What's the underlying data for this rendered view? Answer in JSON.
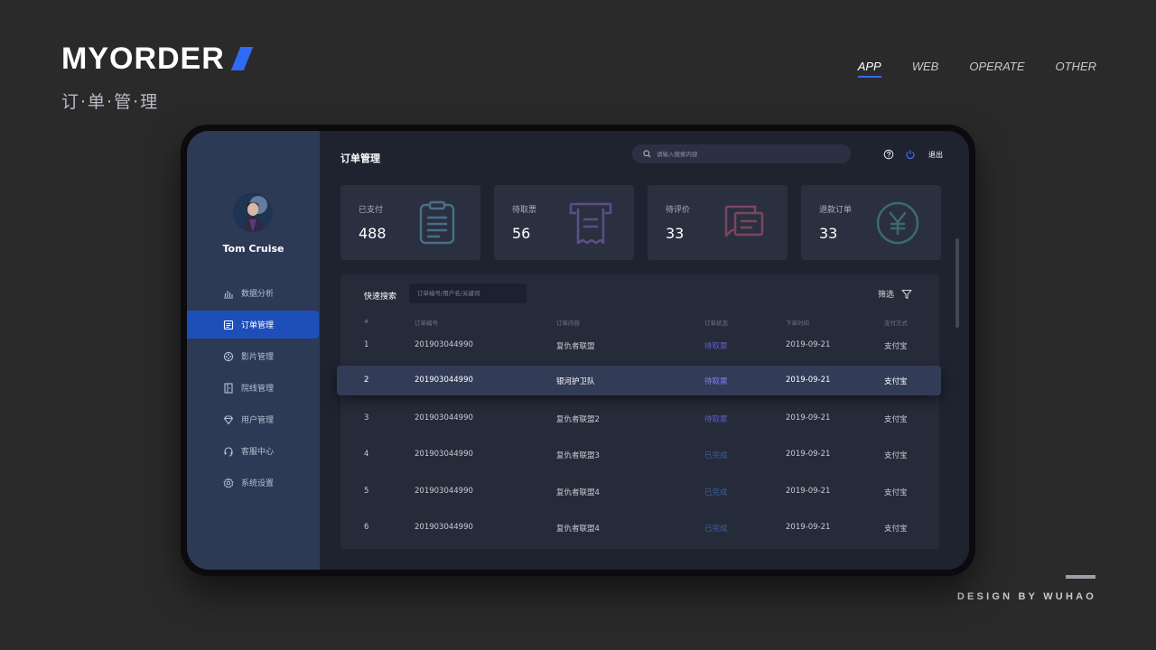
{
  "brand": {
    "title": "MYORDER",
    "subtitle": "订·单·管·理"
  },
  "topnav": [
    {
      "label": "APP",
      "active": true
    },
    {
      "label": "WEB",
      "active": false
    },
    {
      "label": "OPERATE",
      "active": false
    },
    {
      "label": "OTHER",
      "active": false
    }
  ],
  "footer": {
    "credit": "DESIGN BY WUHAO"
  },
  "user": {
    "name": "Tom Cruise"
  },
  "menu": [
    {
      "label": "数据分析",
      "icon": "bar-chart-icon",
      "active": false
    },
    {
      "label": "订单管理",
      "icon": "document-icon",
      "active": true
    },
    {
      "label": "影片管理",
      "icon": "film-reel-icon",
      "active": false
    },
    {
      "label": "院线管理",
      "icon": "door-icon",
      "active": false
    },
    {
      "label": "用户管理",
      "icon": "diamond-icon",
      "active": false
    },
    {
      "label": "客服中心",
      "icon": "headset-icon",
      "active": false
    },
    {
      "label": "系统设置",
      "icon": "gear-icon",
      "active": false
    }
  ],
  "header": {
    "title": "订单管理",
    "search_placeholder": "请输入搜索内容",
    "logout_label": "退出"
  },
  "cards": [
    {
      "label": "已支付",
      "value": "488",
      "icon": "clipboard-icon",
      "color": "#4a6e86"
    },
    {
      "label": "待取票",
      "value": "56",
      "icon": "receipt-icon",
      "color": "#5b4f86"
    },
    {
      "label": "待评价",
      "value": "33",
      "icon": "comment-icon",
      "color": "#7a4660"
    },
    {
      "label": "退款订单",
      "value": "33",
      "icon": "yen-circle-icon",
      "color": "#3c6b66"
    }
  ],
  "table": {
    "quick_search_label": "快速搜索",
    "quick_search_placeholder": "订单编号/用户名/关键词",
    "filter_label": "筛选",
    "columns": [
      "#",
      "订单编号",
      "订单内容",
      "订单状态",
      "下单时间",
      "支付方式"
    ],
    "rows": [
      {
        "index": "1",
        "order_no": "201903044990",
        "content": "复仇者联盟",
        "status": "待取票",
        "status_type": "pending",
        "date": "2019-09-21",
        "payment": "支付宝"
      },
      {
        "index": "2",
        "order_no": "201903044990",
        "content": "银河护卫队",
        "status": "待取票",
        "status_type": "pending",
        "date": "2019-09-21",
        "payment": "支付宝"
      },
      {
        "index": "3",
        "order_no": "201903044990",
        "content": "复仇者联盟2",
        "status": "待取票",
        "status_type": "pending",
        "date": "2019-09-21",
        "payment": "支付宝"
      },
      {
        "index": "4",
        "order_no": "201903044990",
        "content": "复仇者联盟3",
        "status": "已完成",
        "status_type": "done",
        "date": "2019-09-21",
        "payment": "支付宝"
      },
      {
        "index": "5",
        "order_no": "201903044990",
        "content": "复仇者联盟4",
        "status": "已完成",
        "status_type": "done",
        "date": "2019-09-21",
        "payment": "支付宝"
      },
      {
        "index": "6",
        "order_no": "201903044990",
        "content": "复仇者联盟4",
        "status": "已完成",
        "status_type": "done",
        "date": "2019-09-21",
        "payment": "支付宝"
      }
    ]
  },
  "colors": {
    "accent": "#2f6cf6",
    "sidebar": "#2c3a55",
    "active_menu": "#1e4fb8",
    "status_pending": "#5f5fc7",
    "status_done": "#3d5fa0"
  }
}
